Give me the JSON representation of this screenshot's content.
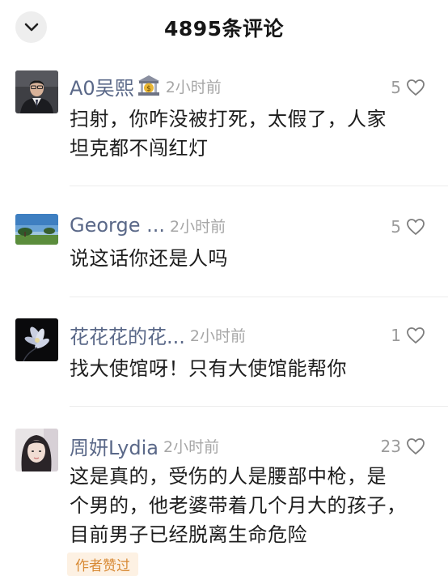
{
  "header": {
    "title": "4895条评论",
    "collapse_icon": "chevron-down-icon"
  },
  "comments": [
    {
      "username": "A0吴熙",
      "badge_icon": "bank-icon",
      "time": "2小时前",
      "likes": "5",
      "text_lines": [
        "扫射，你咋没被打死，太假了，人家",
        "坦克都不闯红灯"
      ]
    },
    {
      "username": "George ...",
      "time": "2小时前",
      "likes": "5",
      "text_lines": [
        "说这话你还是人吗"
      ]
    },
    {
      "username": "花花花的花...",
      "time": "2小时前",
      "likes": "1",
      "text_lines": [
        "找大使馆呀！只有大使馆能帮你"
      ]
    },
    {
      "username": "周妍Lydia",
      "time": "2小时前",
      "likes": "23",
      "text_lines": [
        "这是真的，受伤的人是腰部中枪，是",
        "个男的，他老婆带着几个月大的孩子，",
        "目前男子已经脱离生命危险"
      ],
      "tag": "作者赞过"
    }
  ],
  "colors": {
    "username": "#5a6888",
    "time": "#a6a6a6",
    "tag_text": "#d88a35",
    "tag_bg": "#fdf1e3"
  }
}
